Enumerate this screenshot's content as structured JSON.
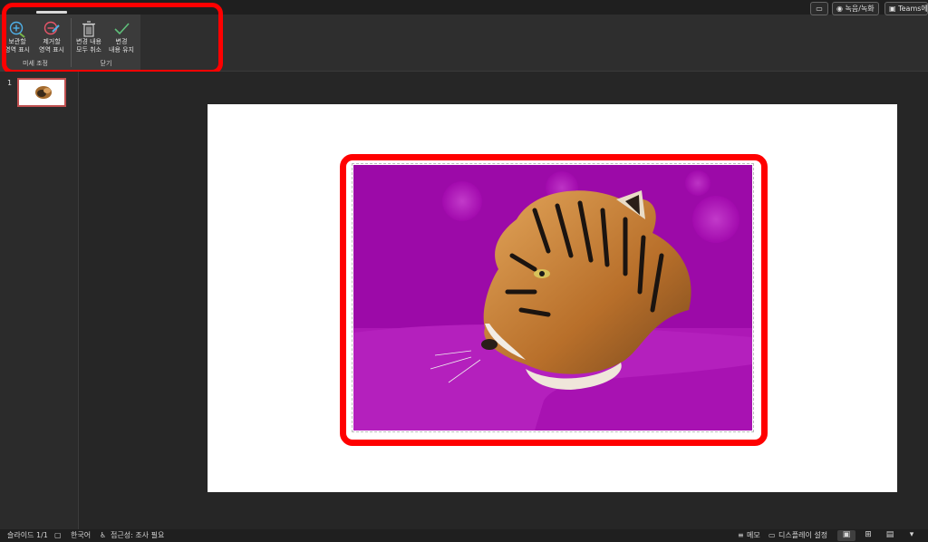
{
  "ribbon": {
    "groups": [
      {
        "label": "미세 조정",
        "buttons": [
          {
            "label1": "보관할",
            "label2": "영역 표시",
            "icon": "plus-pen-icon"
          },
          {
            "label1": "제거할",
            "label2": "영역 표시",
            "icon": "minus-pen-icon"
          }
        ]
      },
      {
        "label": "닫기",
        "buttons": [
          {
            "label1": "변경 내용",
            "label2": "모두 취소",
            "icon": "trash-icon"
          },
          {
            "label1": "변경",
            "label2": "내용 유지",
            "icon": "check-icon"
          }
        ]
      }
    ]
  },
  "topright": {
    "comment_icon": "comment-icon",
    "record_label": "녹음/녹화",
    "teams_label": "Teams에"
  },
  "thumbnails": [
    {
      "number": "1"
    }
  ],
  "status": {
    "slide": "슬라이드 1/1",
    "language": "한국어",
    "accessibility": "접근성: 조사 필요",
    "notes": "메모",
    "display": "디스플레이 설정"
  },
  "colors": {
    "background_removal": "#a50ab0",
    "highlight": "#ff0000"
  }
}
